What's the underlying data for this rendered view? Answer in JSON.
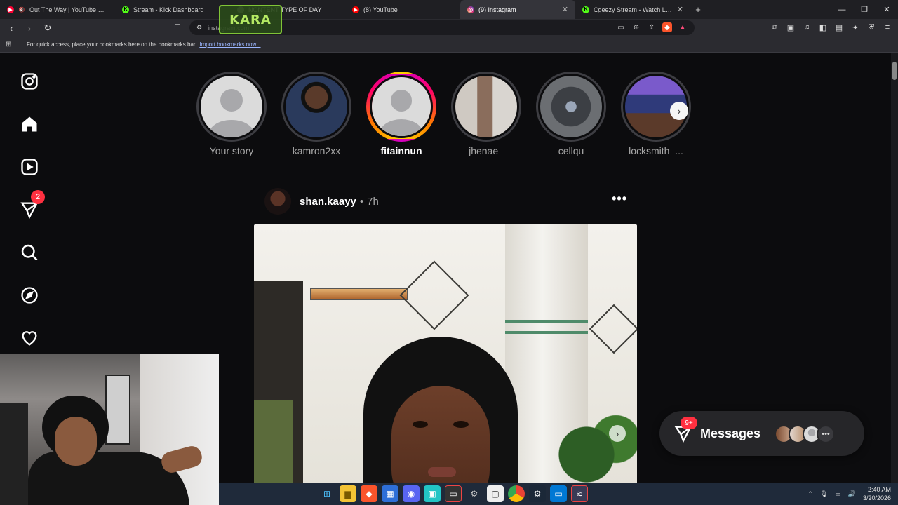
{
  "browser": {
    "tabs": [
      {
        "title": "Out The Way | YouTube Music",
        "icon": "youtube-music-icon",
        "color": "#ff0033",
        "active": false
      },
      {
        "title": "Stream - Kick Dashboard",
        "icon": "kick-icon",
        "color": "#53fc18",
        "active": false
      },
      {
        "title": "NONTENT TYPE OF DAY",
        "icon": "speaker-icon",
        "color": "#888888",
        "active": false
      },
      {
        "title": "(8) YouTube",
        "icon": "youtube-icon",
        "color": "#ff0000",
        "active": false
      },
      {
        "title": "(9) Instagram",
        "icon": "instagram-icon",
        "color": "#e1306c",
        "active": true
      },
      {
        "title": "Cgeezy Stream - Watch Live on Kick",
        "icon": "kick-icon",
        "color": "#53fc18",
        "active": false
      }
    ],
    "url": "instagram.com",
    "bookmarks_hint": "For quick access, place your bookmarks here on the bookmarks bar.",
    "bookmarks_link": "Import bookmarks now...",
    "overlay_logo_text": "KARA"
  },
  "instagram": {
    "nav_badge": "2",
    "stories": [
      {
        "name": "Your story",
        "unseen": false,
        "default_avatar": true,
        "avatar_color": "#dbdbdb"
      },
      {
        "name": "kamron2xx",
        "unseen": false,
        "default_avatar": false,
        "avatar_color": "#2a3a5c"
      },
      {
        "name": "fitainnun",
        "unseen": true,
        "default_avatar": true,
        "avatar_color": "#dbdbdb"
      },
      {
        "name": "jhenae_",
        "unseen": false,
        "default_avatar": false,
        "avatar_color": "#8a6d5c"
      },
      {
        "name": "cellqu",
        "unseen": false,
        "default_avatar": false,
        "avatar_color": "#3c3f44"
      },
      {
        "name": "locksmith_...",
        "unseen": false,
        "default_avatar": false,
        "avatar_color": "#2f3a7a"
      }
    ],
    "post": {
      "username": "shan.kaayy",
      "separator": "•",
      "time": "7h",
      "more_label": "•••"
    },
    "messages": {
      "label": "Messages",
      "badge": "9+",
      "more": "•••"
    }
  },
  "taskbar": {
    "time": "2:40 AM",
    "date": "3/20/2026"
  }
}
